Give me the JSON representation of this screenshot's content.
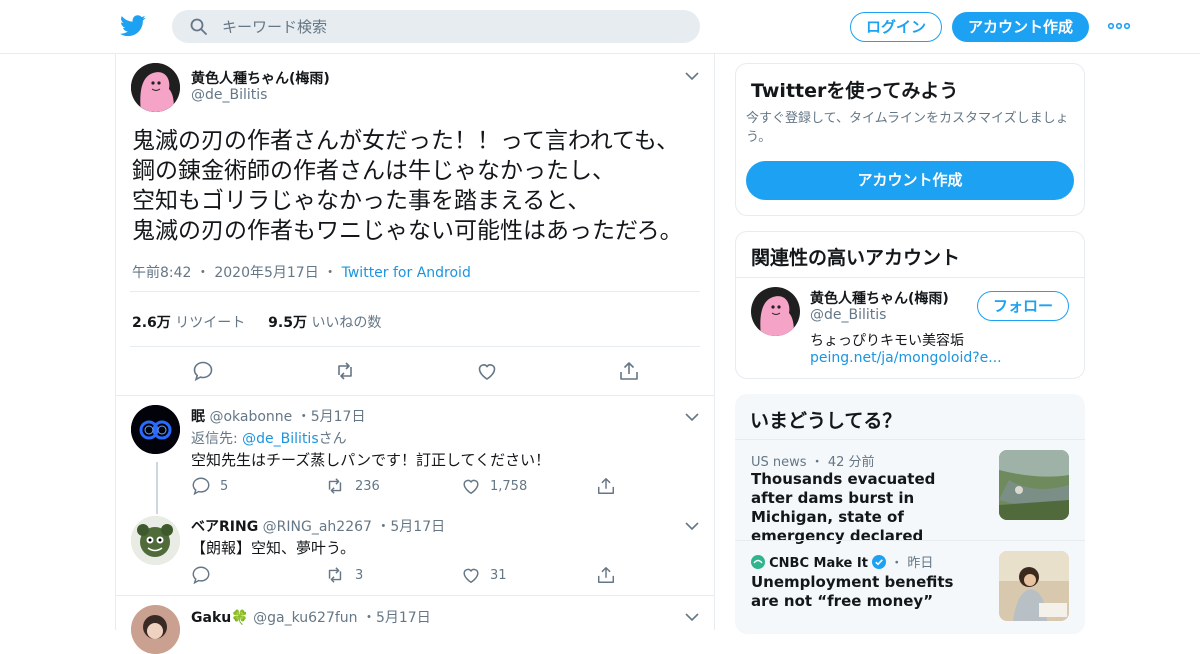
{
  "header": {
    "search_placeholder": "キーワード検索",
    "login_label": "ログイン",
    "signup_label": "アカウント作成",
    "brand_color": "#1da1f2"
  },
  "tweet": {
    "name": "黄色人種ちゃん(梅雨)",
    "handle": "@de_Bilitis",
    "text": "鬼滅の刃の作者さんが女だった！！って言われても、\n鋼の錬金術師の作者さんは牛じゃなかったし、\n空知もゴリラじゃなかった事を踏まえると、\n鬼滅の刃の作者もワニじゃない可能性はあっただろ。",
    "time": "午前8:42",
    "date": "2020年5月17日",
    "via": "Twitter for Android",
    "retweets_count": "2.6万",
    "retweets_label": "リツイート",
    "likes_count": "9.5万",
    "likes_label": "いいねの数"
  },
  "replies": [
    {
      "name": "眠",
      "handle": "@okabonne",
      "date": "5月17日",
      "reply_to_prefix": "返信先: ",
      "reply_to_handle": "@de_Bilitis",
      "reply_to_suffix": "さん",
      "text": "空知先生はチーズ蒸しパンです！訂正してください！",
      "replies": "5",
      "retweets": "236",
      "likes": "1,758"
    },
    {
      "name": "ベアRING",
      "handle": "@RING_ah2267",
      "date": "5月17日",
      "text": "【朗報】空知、夢叶う。",
      "replies": "",
      "retweets": "3",
      "likes": "31"
    },
    {
      "name": "Gaku🍀",
      "handle": "@ga_ku627fun",
      "date": "5月17日"
    }
  ],
  "sidebar": {
    "signup_card": {
      "title": "Twitterを使ってみよう",
      "description": "今すぐ登録して、タイムラインをカスタマイズしましょう。",
      "button": "アカウント作成"
    },
    "relevant": {
      "title": "関連性の高いアカウント",
      "name": "黄色人種ちゃん(梅雨)",
      "handle": "@de_Bilitis",
      "bio": "ちょっぴりキモい美容垢",
      "link": "peing.net/ja/mongoloid?e...",
      "follow_label": "フォロー"
    },
    "trends": {
      "title": "いまどうしてる？",
      "items": [
        {
          "source": "US news",
          "time": "42 分前",
          "headline": "Thousands evacuated after dams burst in Michigan, state of emergency declared"
        },
        {
          "source": "CNBC Make It",
          "time": "昨日",
          "headline": "Unemployment benefits are not “free money”"
        }
      ]
    }
  }
}
